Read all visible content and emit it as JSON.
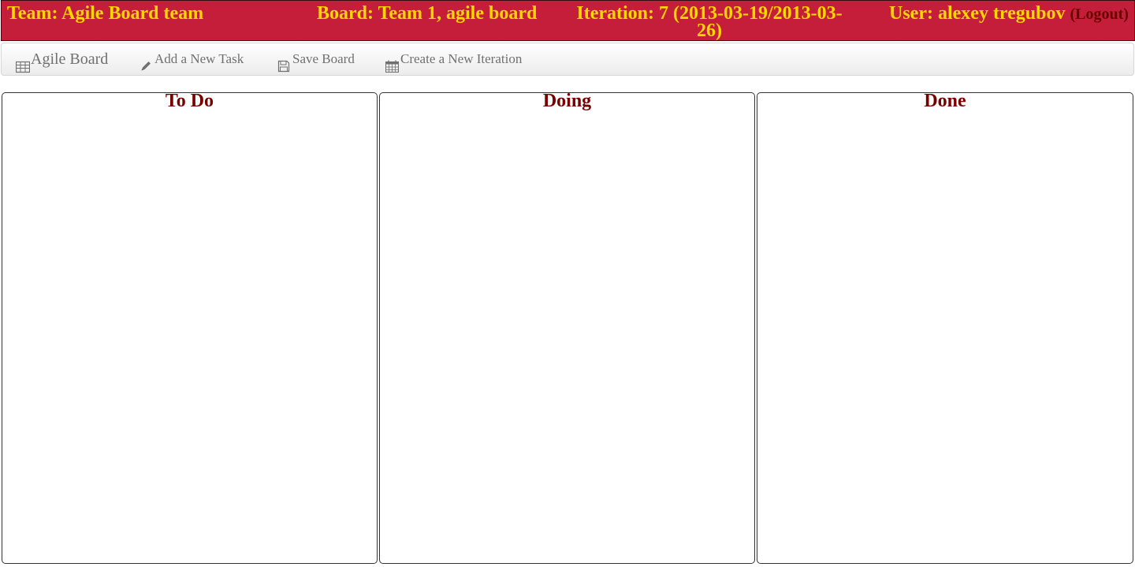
{
  "header": {
    "team": "Team: Agile Board team",
    "board": "Board: Team 1, agile board",
    "iteration": "Iteration: 7 (2013-03-19/2013-03-26)",
    "user": "User: alexey tregubov",
    "logout": "(Logout)",
    "background_color": "#c41e3a",
    "text_color": "#ffd700"
  },
  "toolbar": {
    "brand_label": "Agile Board",
    "brand_icon": "table-icon",
    "add_task_label": "Add a New Task",
    "add_task_icon": "pencil-icon",
    "save_board_label": "Save Board",
    "save_board_icon": "floppy-disk-icon",
    "new_iteration_label": "Create a New Iteration",
    "new_iteration_icon": "calendar-icon"
  },
  "board": {
    "columns": [
      {
        "title": "To Do"
      },
      {
        "title": "Doing"
      },
      {
        "title": "Done"
      }
    ],
    "column_title_color": "#7a0000"
  }
}
